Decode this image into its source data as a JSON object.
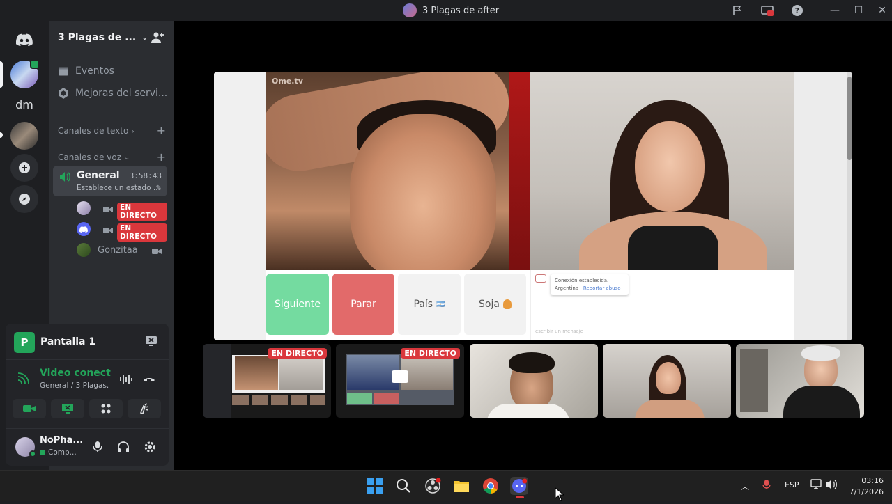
{
  "window": {
    "title": "3 Plagas de after"
  },
  "rail": {
    "dm_label": "dm"
  },
  "guild": {
    "name": "3 Plagas de ..."
  },
  "sidebar": {
    "events": "Eventos",
    "boosts": "Mejoras del servi...",
    "text_category": "Canales de texto",
    "voice_category": "Canales de voz",
    "voice_channel": {
      "name": "General",
      "timer": "3:58:43",
      "status": "Establece un estado ..."
    },
    "voice_users": [
      {
        "name": "",
        "live": "EN DIRECTO"
      },
      {
        "name": "",
        "live": "EN DIRECTO"
      },
      {
        "name": "Gonzitaa",
        "live": ""
      }
    ]
  },
  "panels": {
    "screen_share": {
      "badge": "P",
      "label": "Pantalla 1"
    },
    "voice": {
      "status": "Video conectado",
      "location": "General / 3 Plagas..."
    },
    "user": {
      "name": "NoPha...",
      "status": "Comp..."
    }
  },
  "stream": {
    "logo": "Ome.tv",
    "buttons": [
      {
        "label": "Siguiente",
        "bg": "#74dba0",
        "fg": "#ffffff"
      },
      {
        "label": "Parar",
        "bg": "#e26a6a",
        "fg": "#ffffff"
      },
      {
        "label": "País",
        "bg": "#f2f2f2",
        "fg": "#555555"
      },
      {
        "label": "Soja",
        "bg": "#f2f2f2",
        "fg": "#555555"
      }
    ],
    "chat": {
      "line1": "Conexión establecida.",
      "line2": "Argentina · ",
      "line2_link": "Reportar abuso",
      "placeholder": "escribir un mensaje"
    }
  },
  "thumbnails": [
    {
      "live": "EN DIRECTO"
    },
    {
      "live": "EN DIRECTO"
    },
    {
      "live": ""
    },
    {
      "live": ""
    },
    {
      "live": ""
    }
  ],
  "taskbar": {
    "lang": "ESP",
    "time": "03:16",
    "date": "7/1/2026"
  },
  "colors": {
    "live": "#da373c",
    "online": "#23a55a",
    "sidebar": "#2b2d31",
    "rail": "#1e1f22"
  }
}
